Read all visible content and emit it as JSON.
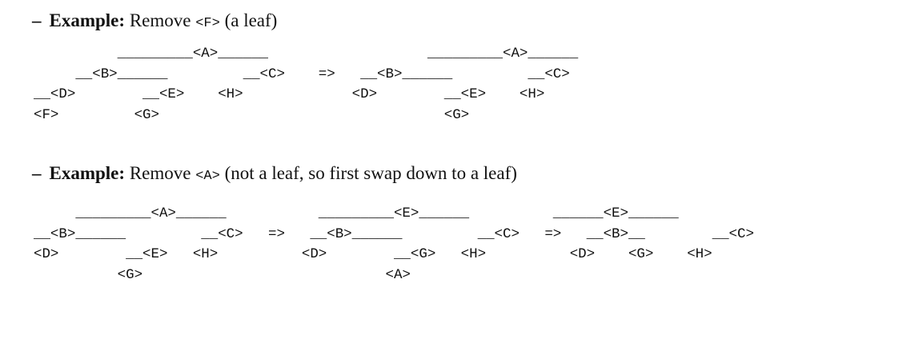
{
  "example1": {
    "dash": "–",
    "lead": "Example:",
    "text1": "Remove",
    "code": "<F>",
    "text2": "(a leaf)"
  },
  "diagram1": [
    "          _________<A>______                   _________<A>______",
    "     __<B>______         __<C>    =>   __<B>______         __<C>",
    "__<D>        __<E>    <H>             <D>        __<E>    <H>",
    "<F>         <G>                                  <G>"
  ],
  "example2": {
    "dash": "–",
    "lead": "Example:",
    "text1": "Remove",
    "code": "<A>",
    "text2": "(not a leaf, so first swap down to a leaf)"
  },
  "diagram2": [
    "     _________<A>______           _________<E>______          ______<E>______",
    "__<B>______         __<C>   =>   __<B>______         __<C>   =>   __<B>__        __<C>",
    "<D>        __<E>   <H>          <D>        __<G>   <H>          <D>    <G>    <H>",
    "          <G>                             <A>"
  ]
}
